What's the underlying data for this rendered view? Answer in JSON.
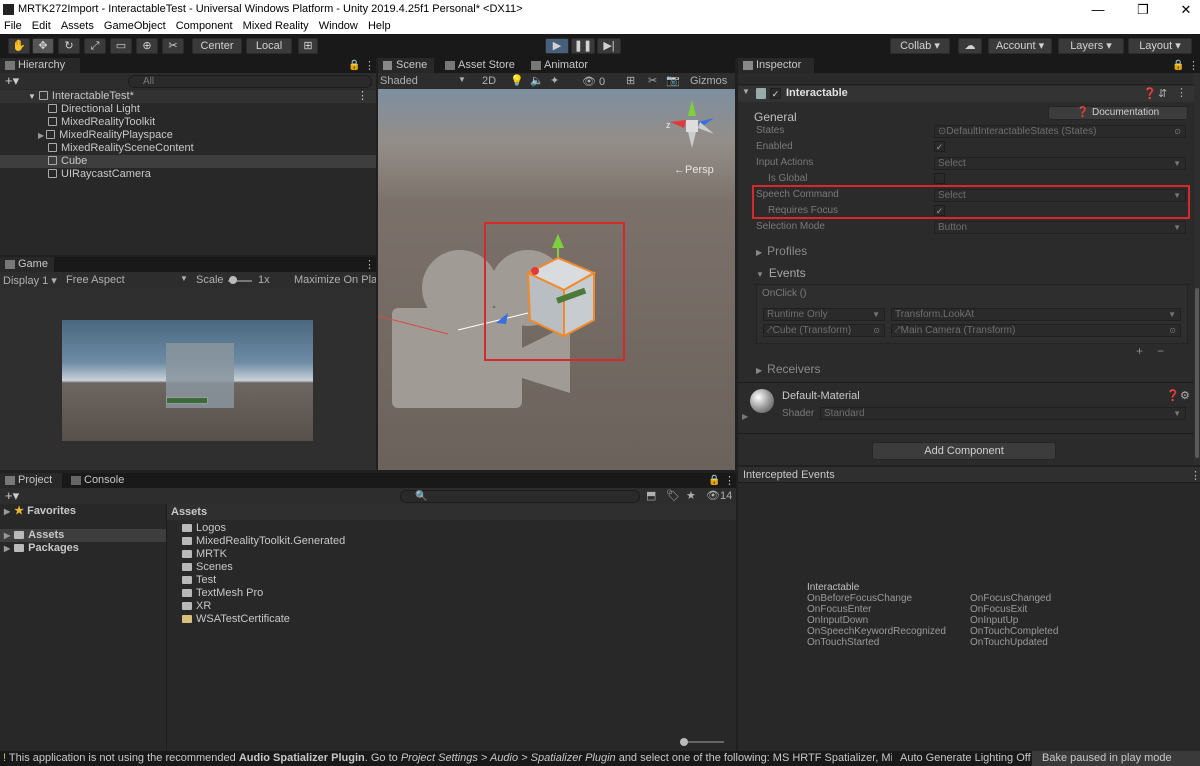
{
  "window": {
    "title": "MRTK272Import - InteractableTest - Universal Windows Platform - Unity 2019.4.25f1 Personal* <DX11>",
    "minimize": "—",
    "maximize": "❐",
    "close": "✕"
  },
  "menu": [
    "File",
    "Edit",
    "Assets",
    "GameObject",
    "Component",
    "Mixed Reality",
    "Window",
    "Help"
  ],
  "toolbar": {
    "center": "Center",
    "local": "Local",
    "collab": "Collab",
    "account": "Account",
    "layers": "Layers",
    "layout": "Layout"
  },
  "hierarchy": {
    "tab": "Hierarchy",
    "search_placeholder": "All",
    "scene": "InteractableTest*",
    "items": [
      "Directional Light",
      "MixedRealityToolkit",
      "MixedRealityPlayspace",
      "MixedRealitySceneContent",
      "Cube",
      "UIRaycastCamera"
    ]
  },
  "scene": {
    "tabs": [
      "Scene",
      "Asset Store",
      "Animator"
    ],
    "shading": "Shaded",
    "mode2d": "2D",
    "hidden_count": "0",
    "gizmos": "Gizmos",
    "persp": "←Persp"
  },
  "game": {
    "tab": "Game",
    "display": "Display 1",
    "aspect": "Free Aspect",
    "scale_label": "Scale",
    "scale_value": "1x",
    "maximize": "Maximize On Play"
  },
  "inspector": {
    "tab": "Inspector",
    "component": "Interactable",
    "documentation": "Documentation",
    "section_general": "General",
    "fields": [
      {
        "label": "States",
        "value": "DefaultInteractableStates (States)"
      },
      {
        "label": "Enabled",
        "value": "✓"
      },
      {
        "label": "Input Actions",
        "value": "Select"
      },
      {
        "label": "Is Global",
        "value": ""
      },
      {
        "label": "Speech Command",
        "value": "Select"
      },
      {
        "label": "Requires Focus",
        "value": "✓"
      },
      {
        "label": "Selection Mode",
        "value": "Button"
      }
    ],
    "profiles": "Profiles",
    "events": "Events",
    "onclick": "OnClick ()",
    "runtime": "Runtime Only",
    "method": "Transform.LookAt",
    "target": "Cube (Transform)",
    "arg": "Main Camera (Transform)",
    "plus": "+",
    "minus": "−",
    "receivers": "Receivers",
    "material": "Default-Material",
    "shader_label": "Shader",
    "shader_value": "Standard",
    "add_component": "Add Component"
  },
  "intercepted": {
    "title": "Intercepted Events",
    "header": "Interactable",
    "left": [
      "OnBeforeFocusChange",
      "OnFocusEnter",
      "OnInputDown",
      "OnSpeechKeywordRecognized",
      "OnTouchStarted"
    ],
    "right": [
      "OnFocusChanged",
      "OnFocusExit",
      "OnInputUp",
      "OnTouchCompleted",
      "OnTouchUpdated"
    ]
  },
  "project": {
    "tabs": [
      "Project",
      "Console"
    ],
    "favorites": "Favorites",
    "assets": "Assets",
    "packages": "Packages",
    "breadcrumb": "Assets",
    "folders": [
      "Logos",
      "MixedRealityToolkit.Generated",
      "MRTK",
      "Scenes",
      "Test",
      "TextMesh Pro",
      "XR",
      "WSATestCertificate"
    ],
    "hidden_count": "14"
  },
  "status": {
    "p1": "This application is not using the recommended ",
    "b1": "Audio Spatializer Plugin",
    "p2": ". Go to ",
    "i1": "Project Settings > Audio > Spatializer Plugin",
    "p3": " and select one of the following: MS HRTF Spatializer, Microsoft S",
    "lighting": "Auto Generate Lighting Off",
    "bake": "Bake paused in play mode"
  },
  "colors": {
    "highlight_box": "#d62a2a",
    "play_active": "#46607c"
  }
}
